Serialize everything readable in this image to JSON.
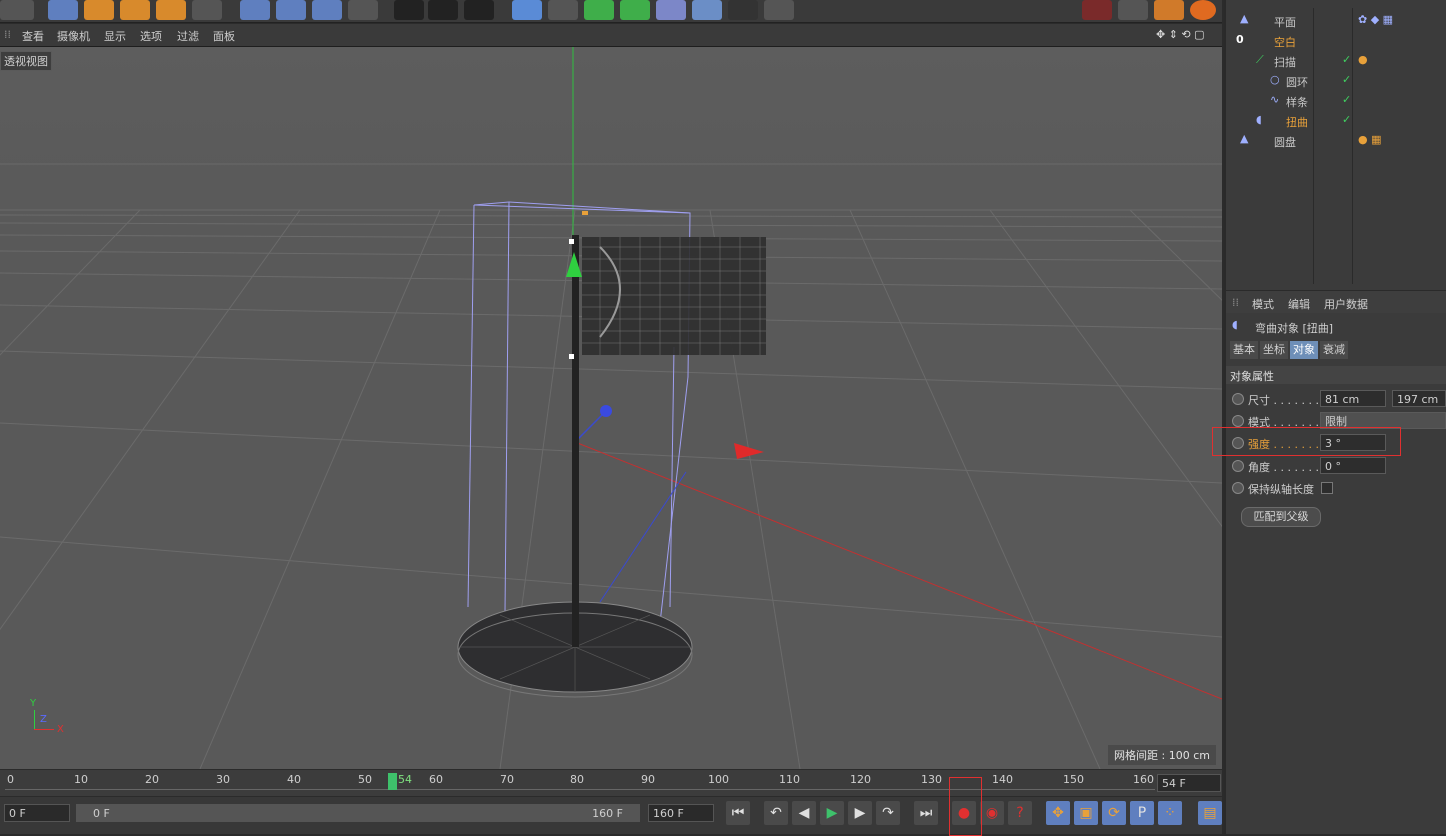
{
  "viewport_menu": {
    "items": [
      "查看",
      "摄像机",
      "显示",
      "选项",
      "过滤",
      "面板"
    ]
  },
  "viewport": {
    "label": "透视视图",
    "grid_spacing": "网格间距 : 100 cm",
    "axis_labels": {
      "y": "Y",
      "z": "Z",
      "x": "X"
    }
  },
  "object_manager": {
    "objects": [
      {
        "name": "平面",
        "highlight": false
      },
      {
        "name": "空白",
        "highlight": true
      },
      {
        "name": "扫描",
        "highlight": false
      },
      {
        "name": "圆环",
        "highlight": false
      },
      {
        "name": "样条",
        "highlight": false
      },
      {
        "name": "扭曲",
        "highlight": true
      },
      {
        "name": "圆盘",
        "highlight": false
      }
    ],
    "null_badge": "0"
  },
  "attributes": {
    "menu": [
      "模式",
      "编辑",
      "用户数据"
    ],
    "object_title": "弯曲对象 [扭曲]",
    "tabs": [
      "基本",
      "坐标",
      "对象",
      "衰减"
    ],
    "active_tab": "对象",
    "section": "对象属性",
    "size_label": "尺寸 . . . . . . .",
    "size_x": "81 cm",
    "size_y": "197 cm",
    "mode_label": "模式 . . . . . . .",
    "mode_value": "限制",
    "strength_label": "强度 . . . . . . .",
    "strength_value": "3 °",
    "angle_label": "角度 . . . . . . .",
    "angle_value": "0 °",
    "keep_length_label": "保持纵轴长度",
    "match_button": "匹配到父级"
  },
  "timeline": {
    "ticks": [
      "0",
      "10",
      "20",
      "30",
      "40",
      "50",
      "60",
      "70",
      "80",
      "90",
      "100",
      "110",
      "120",
      "130",
      "140",
      "150",
      "160"
    ],
    "current_frame": "54",
    "frame_field": "54 F",
    "start_field": "0 F",
    "range_start": "0 F",
    "range_end": "160 F",
    "end_field": "160 F"
  },
  "colors": {
    "accent_orange": "#e8a13a",
    "highlight_red": "#e03030",
    "playhead_green": "#3ec16b",
    "active_tab": "#6e8fb8"
  }
}
